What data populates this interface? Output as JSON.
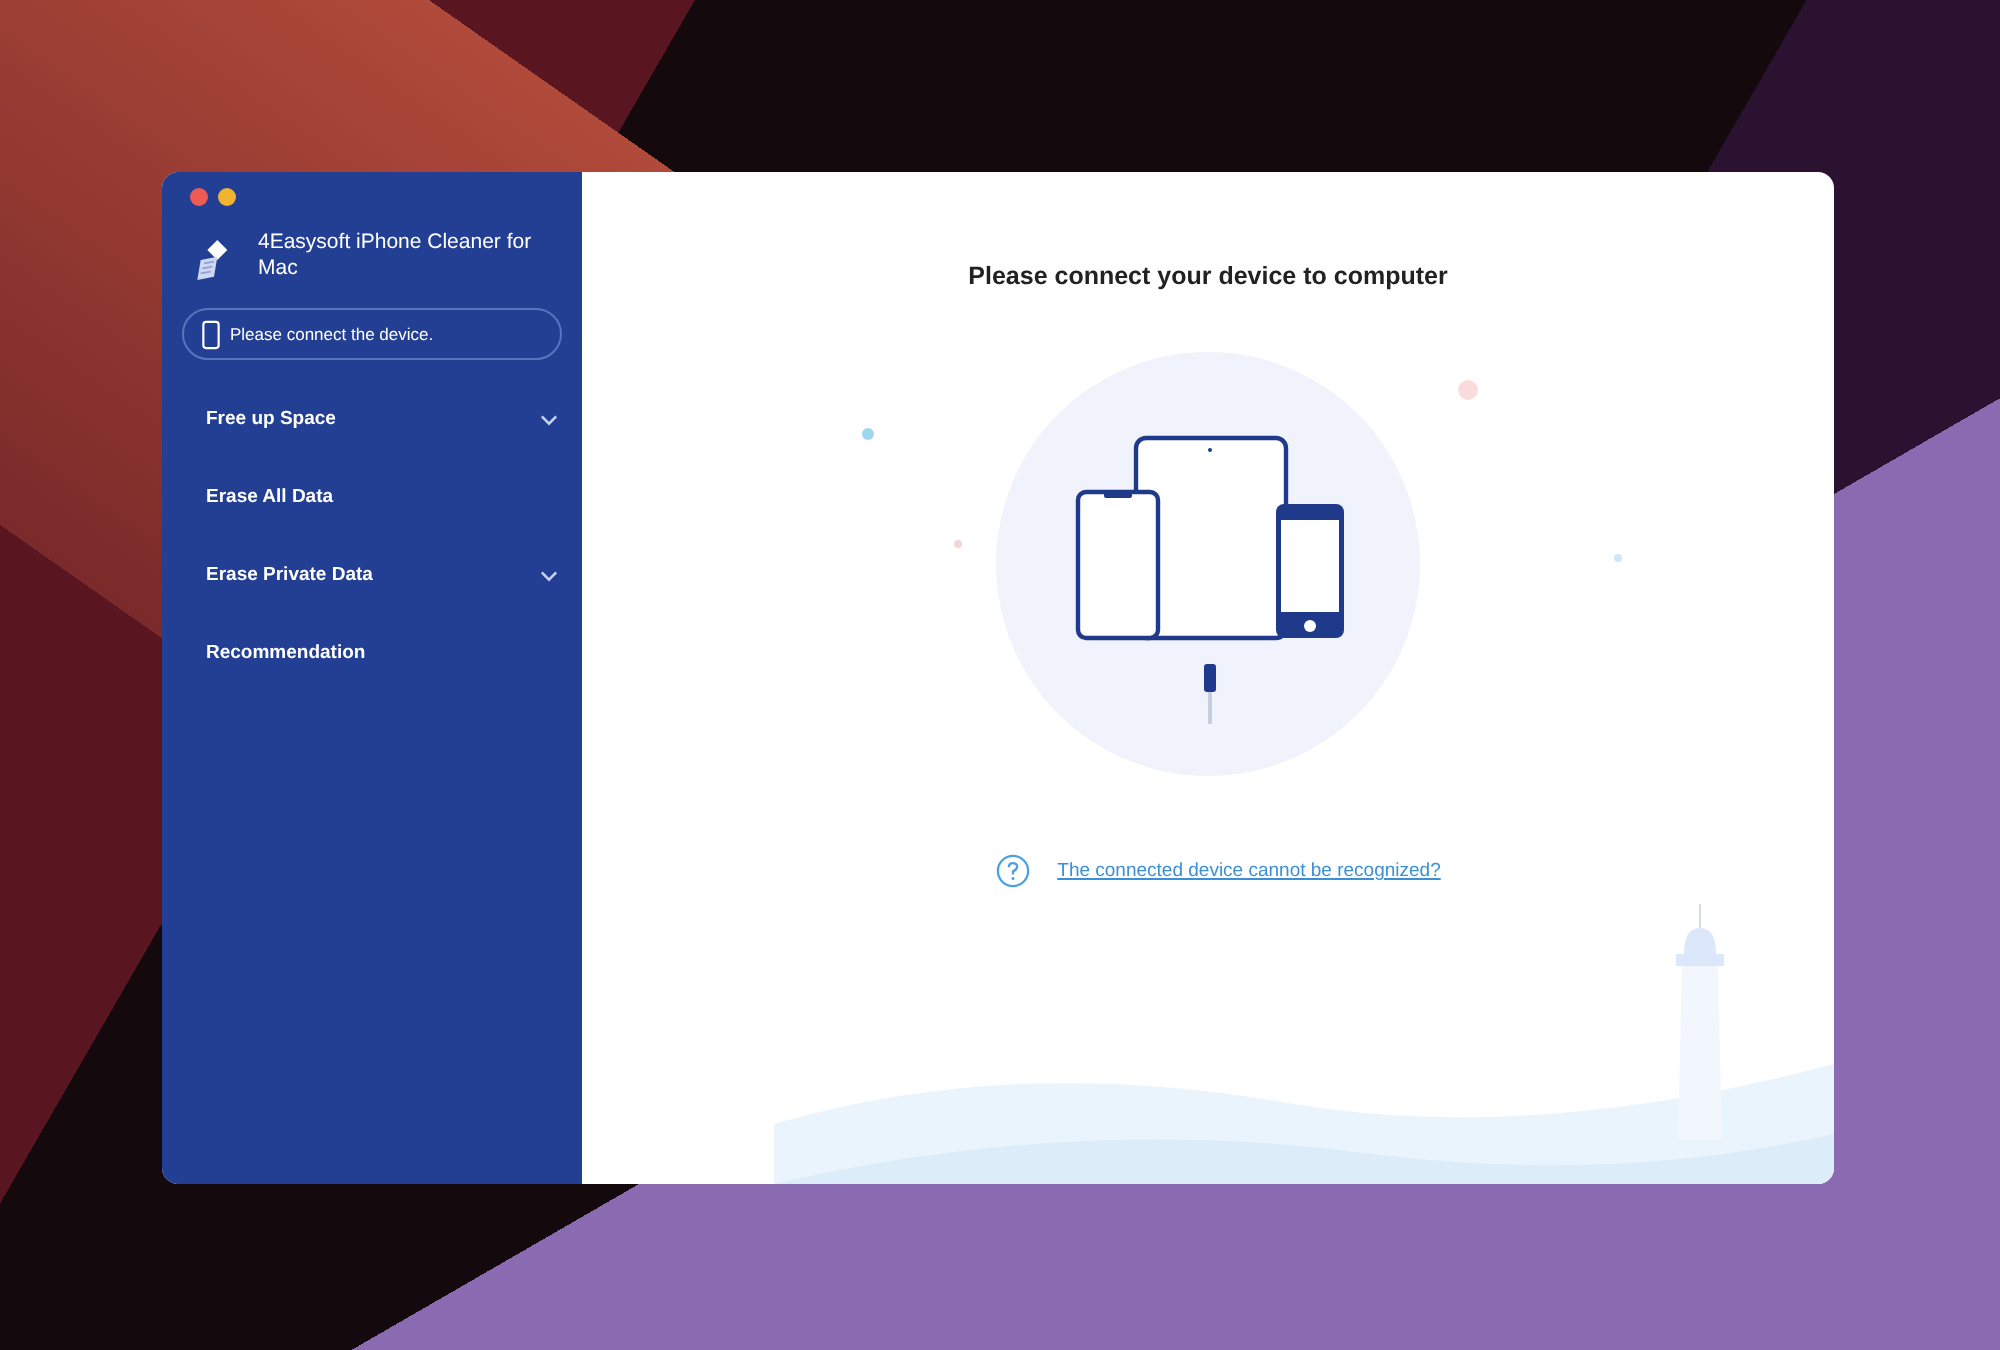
{
  "app": {
    "title": "4Easysoft iPhone Cleaner for Mac"
  },
  "device_status": {
    "text": "Please connect the device."
  },
  "sidebar": {
    "items": [
      {
        "label": "Free up Space",
        "expandable": true
      },
      {
        "label": "Erase All Data",
        "expandable": false
      },
      {
        "label": "Erase Private Data",
        "expandable": true
      },
      {
        "label": "Recommendation",
        "expandable": false
      }
    ]
  },
  "main": {
    "heading": "Please connect your device to computer",
    "help_link": "The connected device cannot be recognized?"
  }
}
